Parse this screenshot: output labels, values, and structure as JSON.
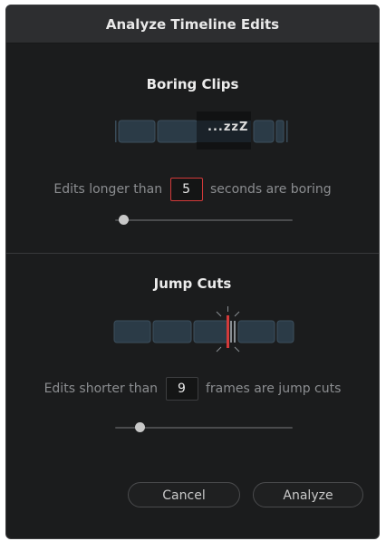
{
  "dialog": {
    "title": "Analyze Timeline Edits",
    "boring_clips": {
      "heading": "Boring Clips",
      "sleep_text": "...zzZ",
      "prefix": "Edits longer than",
      "value": "5",
      "suffix": "seconds are boring",
      "slider_fraction": 0.02
    },
    "jump_cuts": {
      "heading": "Jump Cuts",
      "prefix": "Edits shorter than",
      "value": "9",
      "suffix": "frames are jump cuts",
      "slider_fraction": 0.12
    },
    "buttons": {
      "cancel": "Cancel",
      "analyze": "Analyze"
    },
    "colors": {
      "accent_red": "#d33a3a",
      "clip_fill": "#2b3b47"
    }
  }
}
